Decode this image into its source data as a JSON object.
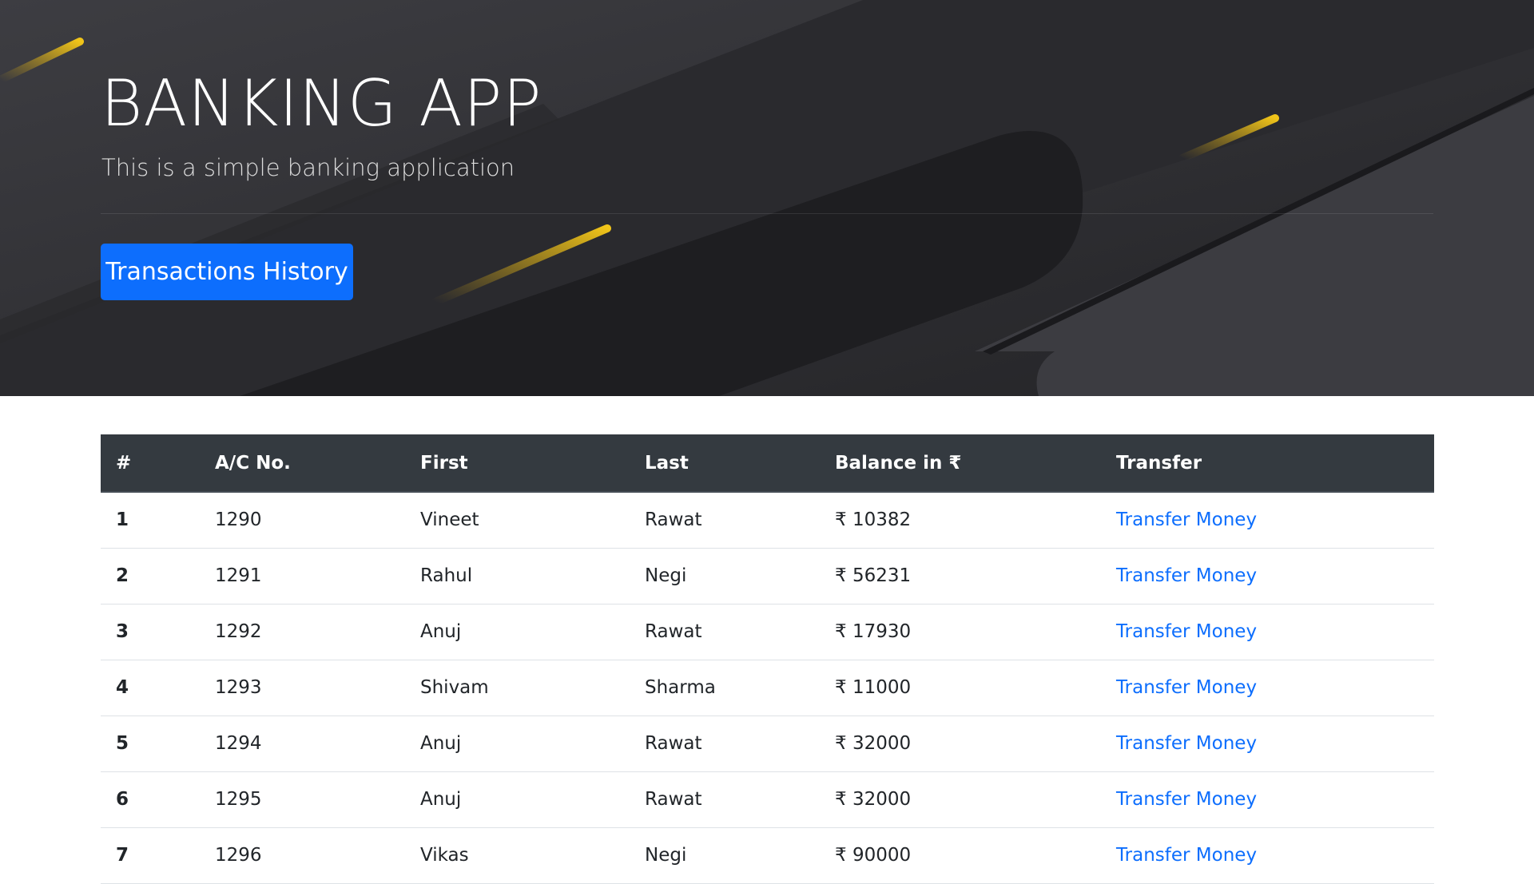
{
  "hero": {
    "title": "BANKING APP",
    "subtitle": "This is a simple banking application",
    "button_label": "Transactions History"
  },
  "table": {
    "headers": [
      "#",
      "A/C No.",
      "First",
      "Last",
      "Balance in ₹",
      "Transfer"
    ],
    "rows": [
      {
        "num": "1",
        "acc": "1290",
        "first": "Vineet",
        "last": "Rawat",
        "balance": "₹ 10382",
        "action": "Transfer Money"
      },
      {
        "num": "2",
        "acc": "1291",
        "first": "Rahul",
        "last": "Negi",
        "balance": "₹ 56231",
        "action": "Transfer Money"
      },
      {
        "num": "3",
        "acc": "1292",
        "first": "Anuj",
        "last": "Rawat",
        "balance": "₹ 17930",
        "action": "Transfer Money"
      },
      {
        "num": "4",
        "acc": "1293",
        "first": "Shivam",
        "last": "Sharma",
        "balance": "₹ 11000",
        "action": "Transfer Money"
      },
      {
        "num": "5",
        "acc": "1294",
        "first": "Anuj",
        "last": "Rawat",
        "balance": "₹ 32000",
        "action": "Transfer Money"
      },
      {
        "num": "6",
        "acc": "1295",
        "first": "Anuj",
        "last": "Rawat",
        "balance": "₹ 32000",
        "action": "Transfer Money"
      },
      {
        "num": "7",
        "acc": "1296",
        "first": "Vikas",
        "last": "Negi",
        "balance": "₹ 90000",
        "action": "Transfer Money"
      }
    ]
  },
  "colors": {
    "primary": "#0d6efd",
    "table_header_bg": "#343a40",
    "hero_bg": "#2e2e32",
    "accent_gold": "#d4a613"
  }
}
